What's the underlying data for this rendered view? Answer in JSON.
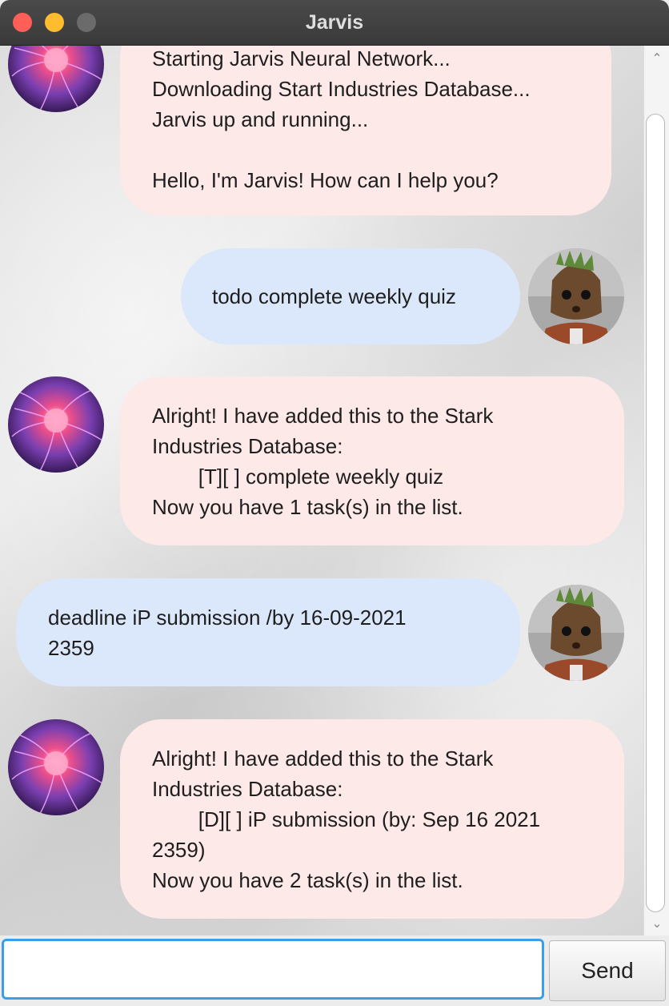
{
  "window": {
    "title": "Jarvis"
  },
  "messages": [
    {
      "sender": "bot",
      "avatar": "plasma-ball-avatar",
      "text": "Starting Jarvis Neural Network...\nDownloading Start Industries Database...\nJarvis up and running...\n\nHello, I'm Jarvis! How can I help you?"
    },
    {
      "sender": "user",
      "avatar": "groot-avatar",
      "text": "todo complete weekly quiz"
    },
    {
      "sender": "bot",
      "avatar": "plasma-ball-avatar",
      "text": "Alright! I have added this to the Stark\nIndustries Database:\n        [T][ ] complete weekly quiz\nNow you have 1 task(s) in the list."
    },
    {
      "sender": "user",
      "avatar": "groot-avatar",
      "text": "deadline iP submission /by 16-09-2021\n2359"
    },
    {
      "sender": "bot",
      "avatar": "plasma-ball-avatar",
      "text": "Alright! I have added this to the Stark\nIndustries Database:\n        [D][ ] iP submission (by: Sep 16 2021\n2359)\nNow you have 2 task(s) in the list."
    }
  ],
  "input": {
    "value": "",
    "placeholder": ""
  },
  "send_button": {
    "label": "Send"
  },
  "scrollbar": {
    "up_icon": "chevron-up-icon",
    "down_icon": "chevron-down-icon"
  },
  "colors": {
    "bot_bubble": "#fde9e8",
    "user_bubble": "#dbe8fb",
    "input_focus": "#3c9ee8"
  }
}
